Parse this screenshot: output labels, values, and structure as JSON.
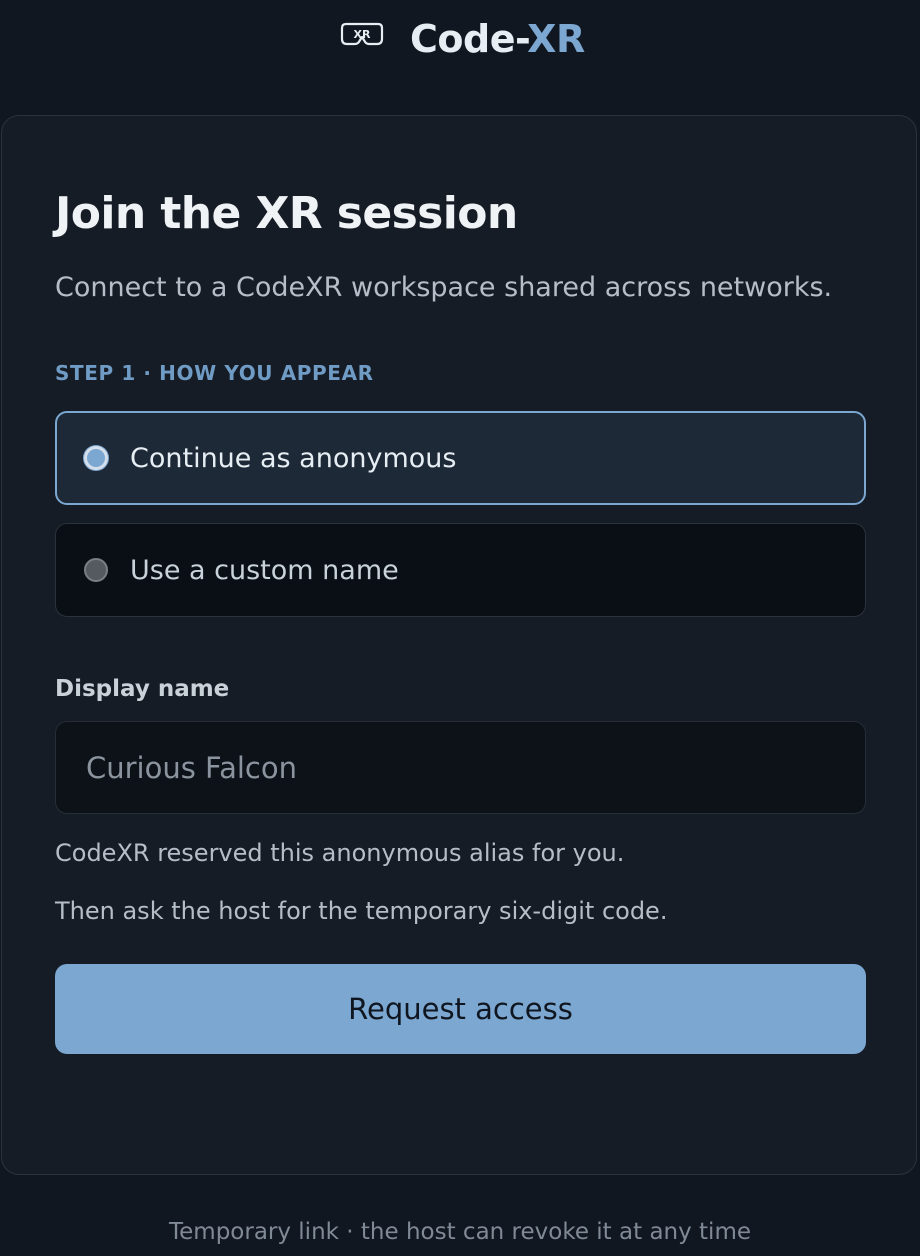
{
  "header": {
    "logo_icon": "vr-headset-icon",
    "logo_icon_text": "XR",
    "brand_part1": "Code-",
    "brand_part2": "XR",
    "brand_accent_color": "#7ba7d1"
  },
  "card": {
    "title": "Join the XR session",
    "subtitle": "Connect to a CodeXR workspace shared across networks.",
    "step_label": "STEP 1 · HOW YOU APPEAR",
    "options": [
      {
        "label": "Continue as anonymous",
        "selected": true
      },
      {
        "label": "Use a custom name",
        "selected": false
      }
    ],
    "display_name": {
      "label": "Display name",
      "value": "Curious Falcon"
    },
    "help_lines": [
      "CodeXR reserved this anonymous alias for you.",
      "Then ask the host for the temporary six-digit code."
    ],
    "primary_button": "Request access"
  },
  "footer": {
    "text": "Temporary link · the host can revoke it at any time"
  },
  "colors": {
    "background": "#111720",
    "card": "#161c25",
    "accent": "#7ba7d1",
    "selected_option_bg": "#1e2937"
  }
}
